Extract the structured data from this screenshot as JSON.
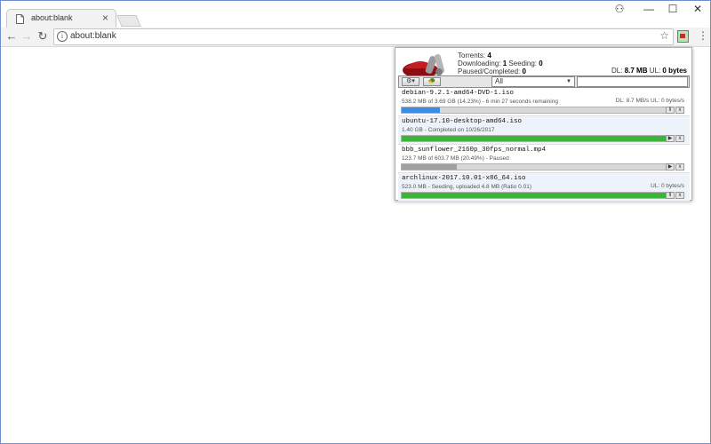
{
  "browser": {
    "tab_title": "about:blank",
    "tab_close": "×",
    "url": "about:blank",
    "window_controls": {
      "account": "⚇",
      "minimize": "—",
      "maximize": "☐",
      "close": "✕"
    },
    "nav": {
      "back": "←",
      "forward": "→",
      "reload": "↻"
    },
    "star": "☆",
    "menu": "⋮"
  },
  "popup": {
    "torrents_label": "Torrents:",
    "torrents_count": "4",
    "downloading_label": "Downloading:",
    "downloading_count": "1",
    "seeding_label": "Seeding:",
    "seeding_count": "0",
    "paused_label": "Paused/Completed:",
    "paused_count": "0",
    "dl_label": "DL:",
    "dl_value": "8.7 MB",
    "ul_label": "UL:",
    "ul_value": "0 bytes",
    "settings_btn": "⚙▾",
    "turtle_btn": "🐢",
    "filter_value": "All",
    "filter_arrow": "▼"
  },
  "torrents": [
    {
      "name": "debian-9.2.1-amd64-DVD-1.iso",
      "status": "538.2 MB of 3.69 GB (14.23%) - 6 min 27 seconds remaining",
      "rate": "DL: 8.7 MB/s UL: 0 bytes/s",
      "progress": 0.1423,
      "color": "#3c8ce6",
      "b1": "ll",
      "b2": "x"
    },
    {
      "name": "ubuntu-17.10-desktop-amd64.iso",
      "status": "1.40 GB - Completed on 10/26/2017",
      "rate": "",
      "progress": 1.0,
      "color": "#3cb43c",
      "b1": "▶",
      "b2": "x"
    },
    {
      "name": "bbb_sunflower_2160p_30fps_normal.mp4",
      "status": "123.7 MB of 603.7 MB (20.49%) - Paused",
      "rate": "",
      "progress": 0.2049,
      "color": "#a0a0a0",
      "b1": "▶",
      "b2": "x"
    },
    {
      "name": "archlinux-2017.10.01-x86_64.iso",
      "status": "523.0 MB - Seeding, uploaded 4.8 MB (Ratio 0.01)",
      "rate": "UL: 0 bytes/s",
      "progress": 1.0,
      "color": "#3cb43c",
      "b1": "ll",
      "b2": "x"
    }
  ],
  "colors": {
    "accent": "#6f8fd0",
    "download": "#3c8ce6",
    "complete": "#3cb43c",
    "paused": "#a0a0a0"
  },
  "icons": [
    "page-icon",
    "account-icon",
    "info-icon",
    "star-icon",
    "extension-icon",
    "menu-icon",
    "gear-icon",
    "turtle-icon",
    "pause-icon",
    "play-icon",
    "remove-icon"
  ]
}
